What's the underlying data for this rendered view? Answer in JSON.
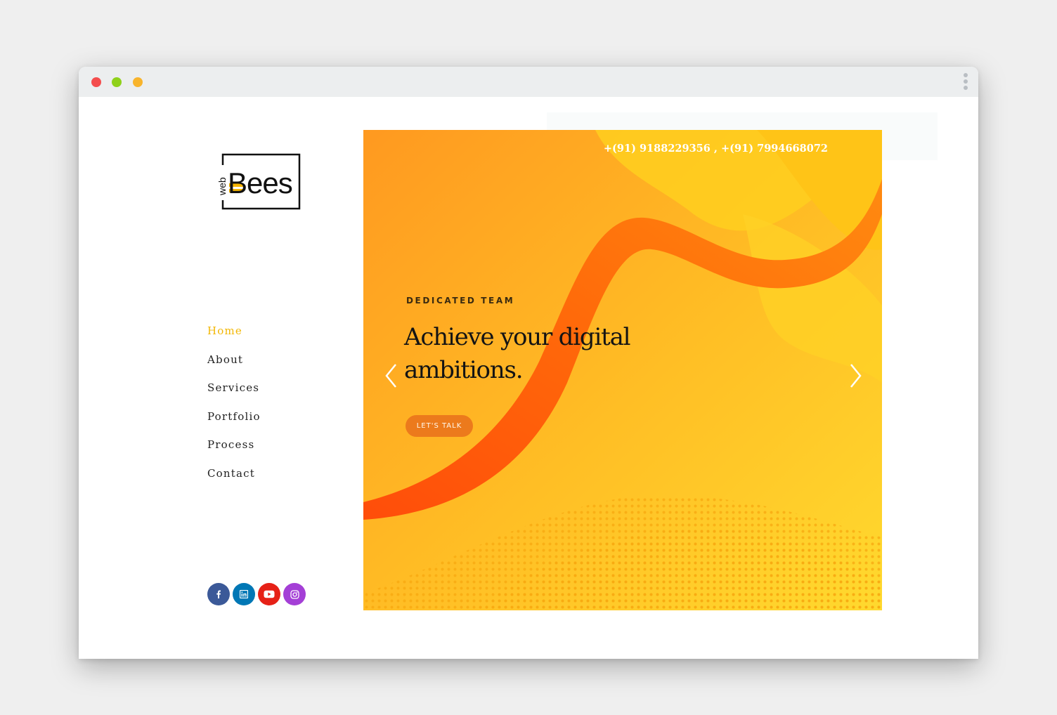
{
  "browser": {
    "controls": [
      "close",
      "minimize",
      "maximize"
    ],
    "colors": {
      "close": "#f44d4d",
      "minimize": "#8fd11a",
      "maximize": "#f8b42c"
    },
    "menu_icon": "kebab-menu-icon"
  },
  "logo": {
    "small_text": "web",
    "main_text": "Bees"
  },
  "nav": {
    "items": [
      {
        "label": "Home",
        "active": true
      },
      {
        "label": "About",
        "active": false
      },
      {
        "label": "Services",
        "active": false
      },
      {
        "label": "Portfolio",
        "active": false
      },
      {
        "label": "Process",
        "active": false
      },
      {
        "label": "Contact",
        "active": false
      }
    ],
    "active_color": "#f2b705"
  },
  "social": [
    {
      "name": "facebook-icon",
      "color": "#3b5998"
    },
    {
      "name": "linkedin-icon",
      "color": "#0077b5"
    },
    {
      "name": "youtube-icon",
      "color": "#e62117"
    },
    {
      "name": "instagram-icon",
      "color": "#a43fd6"
    }
  ],
  "hero": {
    "phone": "+(91) 9188229356 , +(91) 7994668072",
    "eyebrow": "DEDICATED TEAM",
    "headline": "Achieve your digital ambitions.",
    "cta_label": "LET'S TALK",
    "prev_icon": "chevron-left-icon",
    "next_icon": "chevron-right-icon",
    "colors": {
      "orange": "#ff9a1f",
      "yellow": "#ffd52e",
      "ribbon": "#ff6a0a"
    }
  }
}
